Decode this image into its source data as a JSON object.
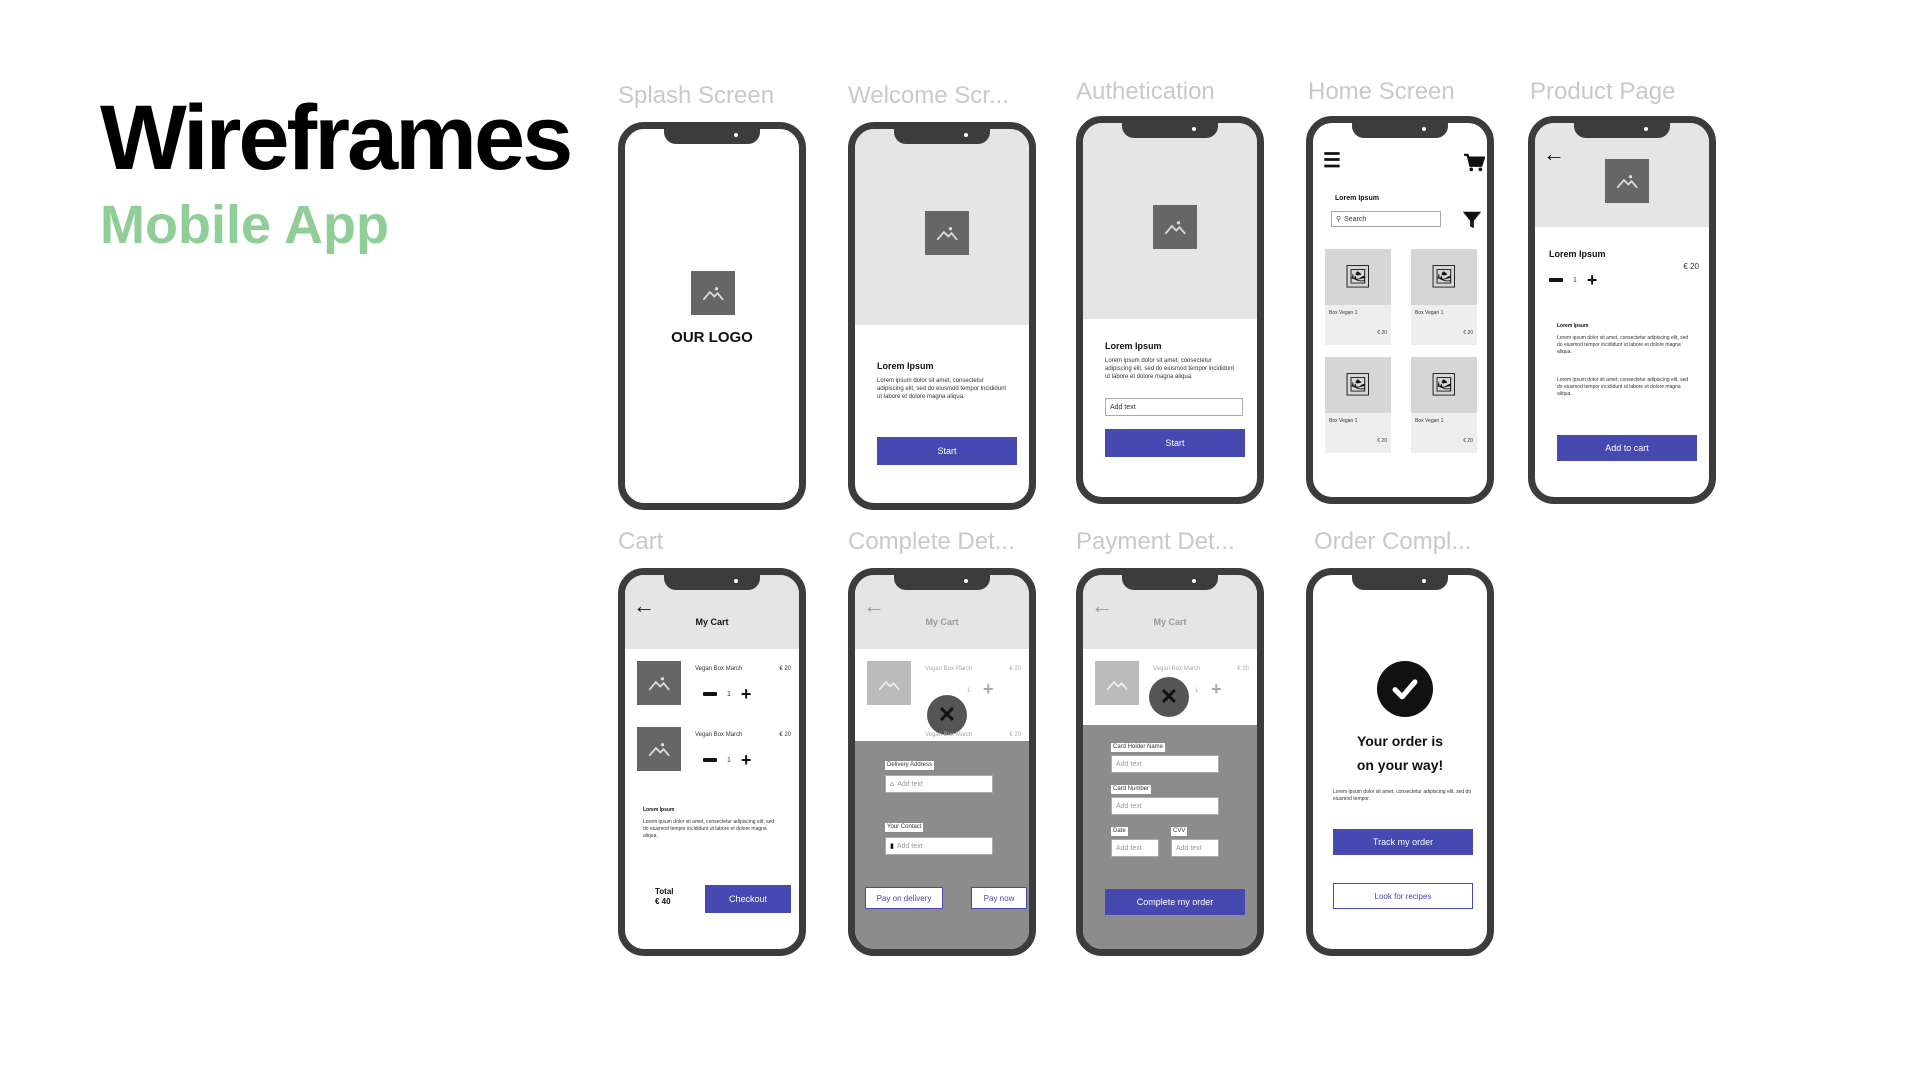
{
  "page": {
    "title": "Wireframes",
    "subtitle": "Mobile App"
  },
  "labels": {
    "splash": "Splash Screen",
    "welcome": "Welcome Scr...",
    "auth": "Authetication",
    "home": "Home Screen",
    "product": "Product Page",
    "cart": "Cart",
    "complete": "Complete Det...",
    "payment": "Payment Det...",
    "order": "Order Compl..."
  },
  "splash": {
    "logo_text": "OUR LOGO"
  },
  "welcome": {
    "heading": "Lorem Ipsum",
    "body": "Lorem ipsum dolor sit amet, consectetur adipiscing elit, sed do eiusmod tempor incididunt ut labore et dolore magna aliqua.",
    "button": "Start"
  },
  "auth": {
    "heading": "Lorem Ipsum",
    "body": "Lorem ipsum dolor sit amet, consectetur adipiscing elit, sed do eiusmod tempor incididunt ut labore et dolore magna aliqua.",
    "input_value": "Add text",
    "button": "Start"
  },
  "home": {
    "heading": "Lorem Ipsum",
    "search_placeholder": "Search",
    "products": [
      {
        "name": "Box Vegan 1",
        "price": "€ 20"
      },
      {
        "name": "Box Vegan 1",
        "price": "€ 20"
      },
      {
        "name": "Box Vegan 1",
        "price": "€ 20"
      },
      {
        "name": "Box Vegan 1",
        "price": "€ 20"
      }
    ]
  },
  "product": {
    "title": "Lorem Ipsum",
    "price": "€ 20",
    "qty": "1",
    "desc_heading": "Lorem Ipsum",
    "desc1": "Lorem ipsum dolor sit amet, consectetur adipiscing elit, sed do eiusmod tempor incididunt ut labore et dolore magna aliqua.",
    "desc2": "Lorem ipsum dolor sit amet, consectetur adipiscing elit, sed do eiusmod tempor incididunt ut labore et dolore magna aliqua.",
    "button": "Add to cart"
  },
  "cart": {
    "title": "My Cart",
    "items": [
      {
        "name": "Vegan Box March",
        "price": "€ 20",
        "qty": "1"
      },
      {
        "name": "Vegan Box March",
        "price": "€ 20",
        "qty": "1"
      }
    ],
    "desc_heading": "Lorem Ipsum",
    "desc": "Lorem ipsum dolor sit amet, consectetur adipiscing elit, sed do eiusmod tempor incididunt ut labore et dolore magna aliqua.",
    "total_label": "Total",
    "total_value": "€ 40",
    "checkout": "Checkout"
  },
  "complete": {
    "title": "My Cart",
    "item1": "Vegan Box March",
    "item2": "Vegan Box March",
    "price": "€ 20",
    "qty": "1",
    "delivery_label": "Delivery Address",
    "delivery_placeholder": "Add text",
    "contact_label": "Your Contact",
    "contact_placeholder": "Add text",
    "pay_delivery": "Pay on delivery",
    "pay_now": "Pay now"
  },
  "payment": {
    "title": "My Cart",
    "item1": "Vegan Box March",
    "price": "€ 20",
    "qty": "1",
    "holder_label": "Card Holder Name",
    "holder_placeholder": "Add text",
    "number_label": "Card Number",
    "number_placeholder": "Add text",
    "date_label": "Date",
    "date_placeholder": "Add text",
    "cvv_label": "CVV",
    "cvv_placeholder": "Add text",
    "button": "Complete my order"
  },
  "order": {
    "message_line1": "Your order is",
    "message_line2": "on your way!",
    "body": "Lorem ipsum dolor sit amet, consectetur adipiscing elit, sed do eiusmod tempor.",
    "track_button": "Track my order",
    "recipes_button": "Look for recipes"
  },
  "colors": {
    "accent": "#4549b0",
    "subtitle": "#8fce97",
    "frame": "#3c3c3c"
  }
}
